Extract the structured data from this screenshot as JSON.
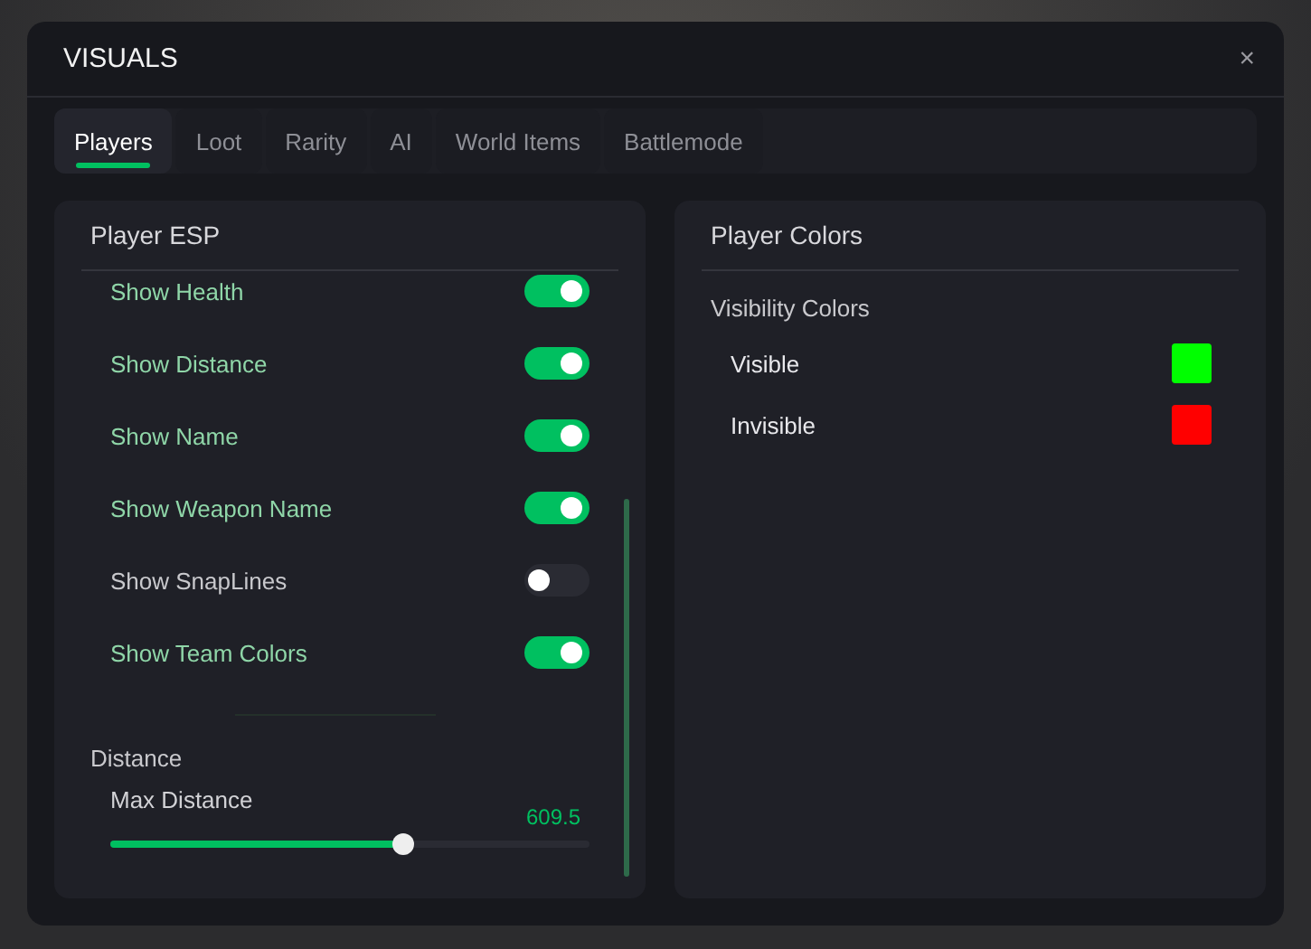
{
  "window": {
    "title": "VISUALS",
    "close": "×"
  },
  "tabs": [
    {
      "label": "Players",
      "selected": true
    },
    {
      "label": "Loot",
      "selected": false
    },
    {
      "label": "Rarity",
      "selected": false
    },
    {
      "label": "AI",
      "selected": false
    },
    {
      "label": "World Items",
      "selected": false
    },
    {
      "label": "Battlemode",
      "selected": false
    }
  ],
  "player_esp": {
    "title": "Player ESP",
    "toggles": [
      {
        "label": "Show Health",
        "on": true
      },
      {
        "label": "Show Distance",
        "on": true
      },
      {
        "label": "Show Name",
        "on": true
      },
      {
        "label": "Show Weapon Name",
        "on": true
      },
      {
        "label": "Show SnapLines",
        "on": false
      },
      {
        "label": "Show Team Colors",
        "on": true
      }
    ],
    "distance": {
      "title": "Distance",
      "label": "Max Distance",
      "reading": "609.5",
      "level": 0.61
    }
  },
  "player_colors": {
    "title": "Player Colors",
    "section": "Visibility Colors",
    "colors": [
      {
        "label": "Visible",
        "color": "#00ff00"
      },
      {
        "label": "Invisible",
        "color": "#ff0000"
      }
    ]
  }
}
